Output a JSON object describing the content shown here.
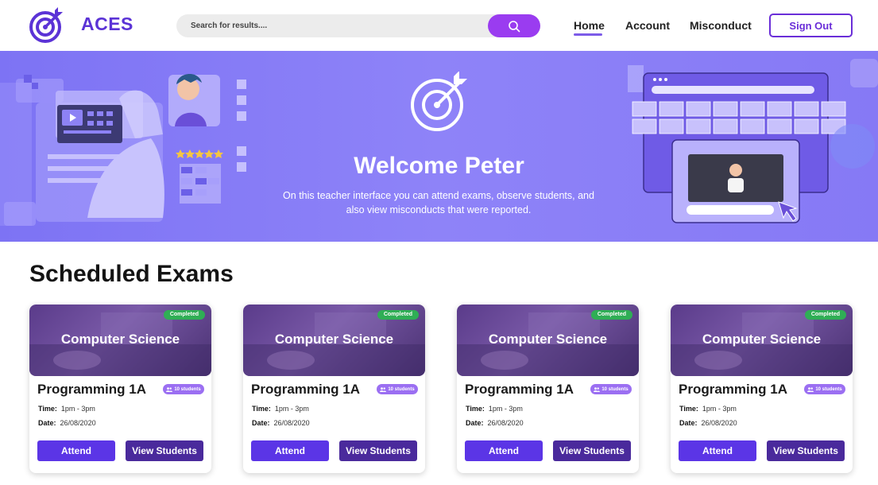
{
  "app": {
    "name": "ACES"
  },
  "search": {
    "placeholder": "Search for results...."
  },
  "nav": {
    "home": "Home",
    "account": "Account",
    "misconduct": "Misconduct",
    "sign_out": "Sign Out"
  },
  "hero": {
    "title": "Welcome Peter",
    "description": "On this teacher interface you can attend exams, observe students, and also view misconducts that were reported."
  },
  "section": {
    "title": "Scheduled Exams"
  },
  "labels": {
    "time": "Time",
    "date": "Date"
  },
  "exams": [
    {
      "subject": "Computer Science",
      "status": "Completed",
      "course": "Programming 1A",
      "students": "10 students",
      "time": "1pm - 3pm",
      "date": "26/08/2020",
      "attend_label": "Attend",
      "view_label": "View Students"
    },
    {
      "subject": "Computer Science",
      "status": "Completed",
      "course": "Programming 1A",
      "students": "10 students",
      "time": "1pm - 3pm",
      "date": "26/08/2020",
      "attend_label": "Attend",
      "view_label": "View Students"
    },
    {
      "subject": "Computer Science",
      "status": "Completed",
      "course": "Programming 1A",
      "students": "10 students",
      "time": "1pm - 3pm",
      "date": "26/08/2020",
      "attend_label": "Attend",
      "view_label": "View Students"
    },
    {
      "subject": "Computer Science",
      "status": "Completed",
      "course": "Programming 1A",
      "students": "10 students",
      "time": "1pm - 3pm",
      "date": "26/08/2020",
      "attend_label": "Attend",
      "view_label": "View Students"
    }
  ],
  "colors": {
    "brand": "#5b33d6",
    "search_button": "#9a3cf0",
    "hero_bg": "#8a80f7",
    "attend_button": "#5b35e6",
    "view_button": "#4a2a9c",
    "completed_badge": "#2fae55",
    "students_badge": "#9b6ff2"
  },
  "icons": {
    "logo": "target-arrow-icon",
    "search": "search-icon",
    "students": "people-icon"
  }
}
